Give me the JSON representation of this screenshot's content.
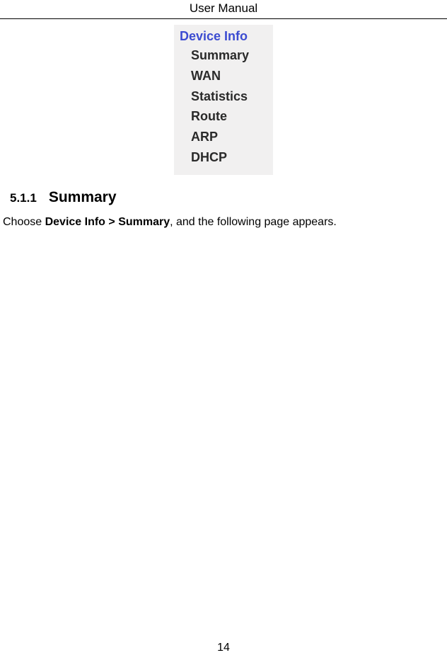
{
  "header": "User Manual",
  "menu": {
    "top": "Device Info",
    "items": [
      "Summary",
      "WAN",
      "Statistics",
      "Route",
      "ARP",
      "DHCP"
    ]
  },
  "section": {
    "number": "5.1.1",
    "title": "Summary"
  },
  "body": {
    "prefix": "Choose ",
    "bold": "Device Info > Summary",
    "suffix": ", and the following page appears."
  },
  "page_number": "14"
}
